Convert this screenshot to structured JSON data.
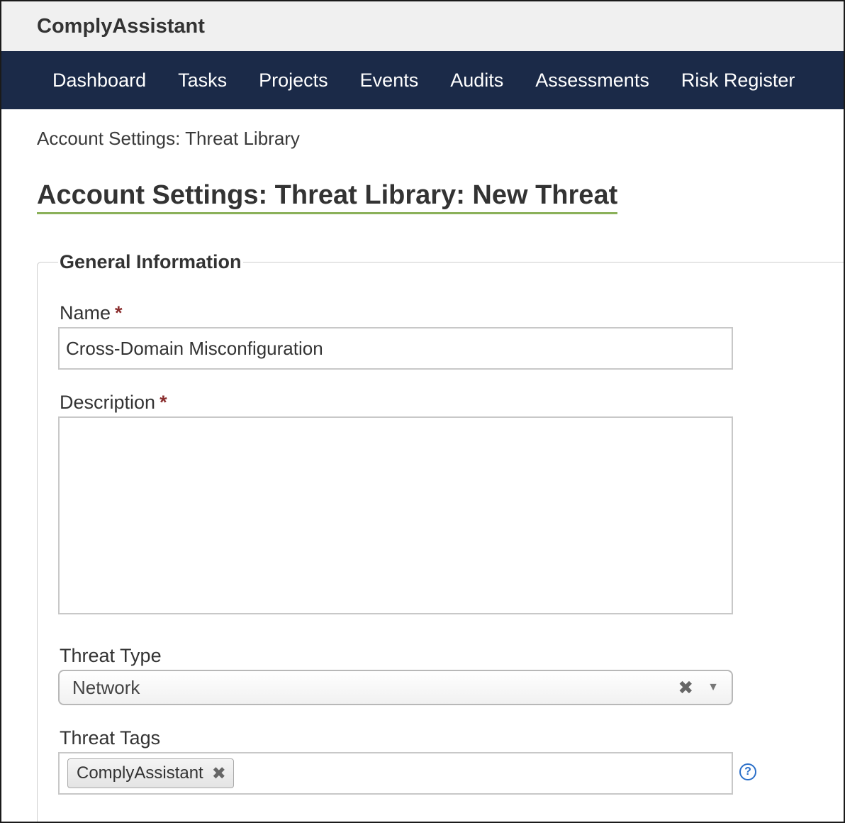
{
  "app": {
    "title": "ComplyAssistant"
  },
  "nav": {
    "items": [
      {
        "label": "Dashboard"
      },
      {
        "label": "Tasks"
      },
      {
        "label": "Projects"
      },
      {
        "label": "Events"
      },
      {
        "label": "Audits"
      },
      {
        "label": "Assessments"
      },
      {
        "label": "Risk Register"
      }
    ]
  },
  "breadcrumb": "Account Settings: Threat Library",
  "page_title": "Account Settings: Threat Library: New Threat",
  "form": {
    "legend": "General Information",
    "name": {
      "label": "Name",
      "required_mark": "*",
      "value": "Cross-Domain Misconfiguration"
    },
    "description": {
      "label": "Description",
      "required_mark": "*",
      "value": ""
    },
    "threat_type": {
      "label": "Threat Type",
      "value": "Network",
      "clear_glyph": "✖",
      "arrow_glyph": "▼"
    },
    "threat_tags": {
      "label": "Threat Tags",
      "tags": [
        {
          "label": "ComplyAssistant",
          "remove_glyph": "✖"
        }
      ],
      "help_glyph": "?"
    }
  },
  "icons": {
    "clear": "close-icon",
    "dropdown": "chevron-down-icon",
    "tag_remove": "close-icon",
    "help": "help-circle-icon"
  },
  "colors": {
    "navbar_bg": "#1b2a48",
    "topbar_bg": "#f0f0f0",
    "title_underline": "#8bb15a",
    "required": "#8a2e2e",
    "help": "#2a6fc9"
  }
}
